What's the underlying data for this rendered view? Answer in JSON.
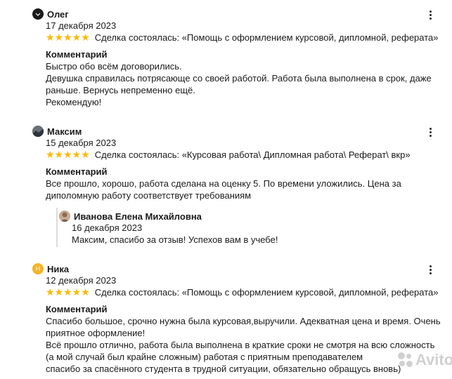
{
  "stars_glyph": "★★★★★",
  "rating_color": "#ffb800",
  "reviews": [
    {
      "author": "Олег",
      "avatar_letter": "",
      "avatar_color": "#1a1a1a",
      "date": "17 декабря 2023",
      "rating": 5,
      "deal": "Сделка состоялась: «Помощь с оформлением курсовой, дипломной, реферата»",
      "comment_title": "Комментарий",
      "comment_lines": [
        "Быстро обо всём договорились.",
        "Девушка справилась потрясающе со своей работой. Работа была выполнена в срок, даже",
        "раньше. Вернусь непременно ещё.",
        "Рекомендую!"
      ]
    },
    {
      "author": "Максим",
      "avatar_letter": "",
      "avatar_color": "#4a4f57",
      "date": "15 декабря 2023",
      "rating": 5,
      "deal": "Сделка состоялась: «Курсовая работа\\ Дипломная работа\\ Реферат\\ вкр»",
      "comment_title": "Комментарий",
      "comment_lines": [
        "Все прошло, хорошо, работа сделана на оценку 5. По времени уложились. Цена за",
        "диполомную работу соответствует требованиям"
      ],
      "reply": {
        "author": "Иванова Елена Михайловна",
        "avatar_color": "#b89a80",
        "date": "16 декабря 2023",
        "text": "Максим, спасибо за отзыв! Успехов вам в учебе!"
      }
    },
    {
      "author": "Ника",
      "avatar_letter": "Н",
      "avatar_color": "#f5b324",
      "date": "12 декабря 2023",
      "rating": 5,
      "deal": "Сделка состоялась: «Помощь с оформлением курсовой, дипломной, реферата»",
      "comment_title": "Комментарий",
      "comment_lines": [
        "Спасибо большое, срочно нужна была курсовая,выручили. Адекватная цена и время. Очень",
        "приятное оформление!",
        "Всё прошло отлично, работа была выполнена в краткие сроки не смотря на всю сложность",
        "(а мой случай был крайне сложным) работая с приятным преподавателем",
        "спасибо за спасённого студента в трудной ситуации, обязательно обращусь вновь)"
      ]
    }
  ],
  "watermark": "Avito"
}
